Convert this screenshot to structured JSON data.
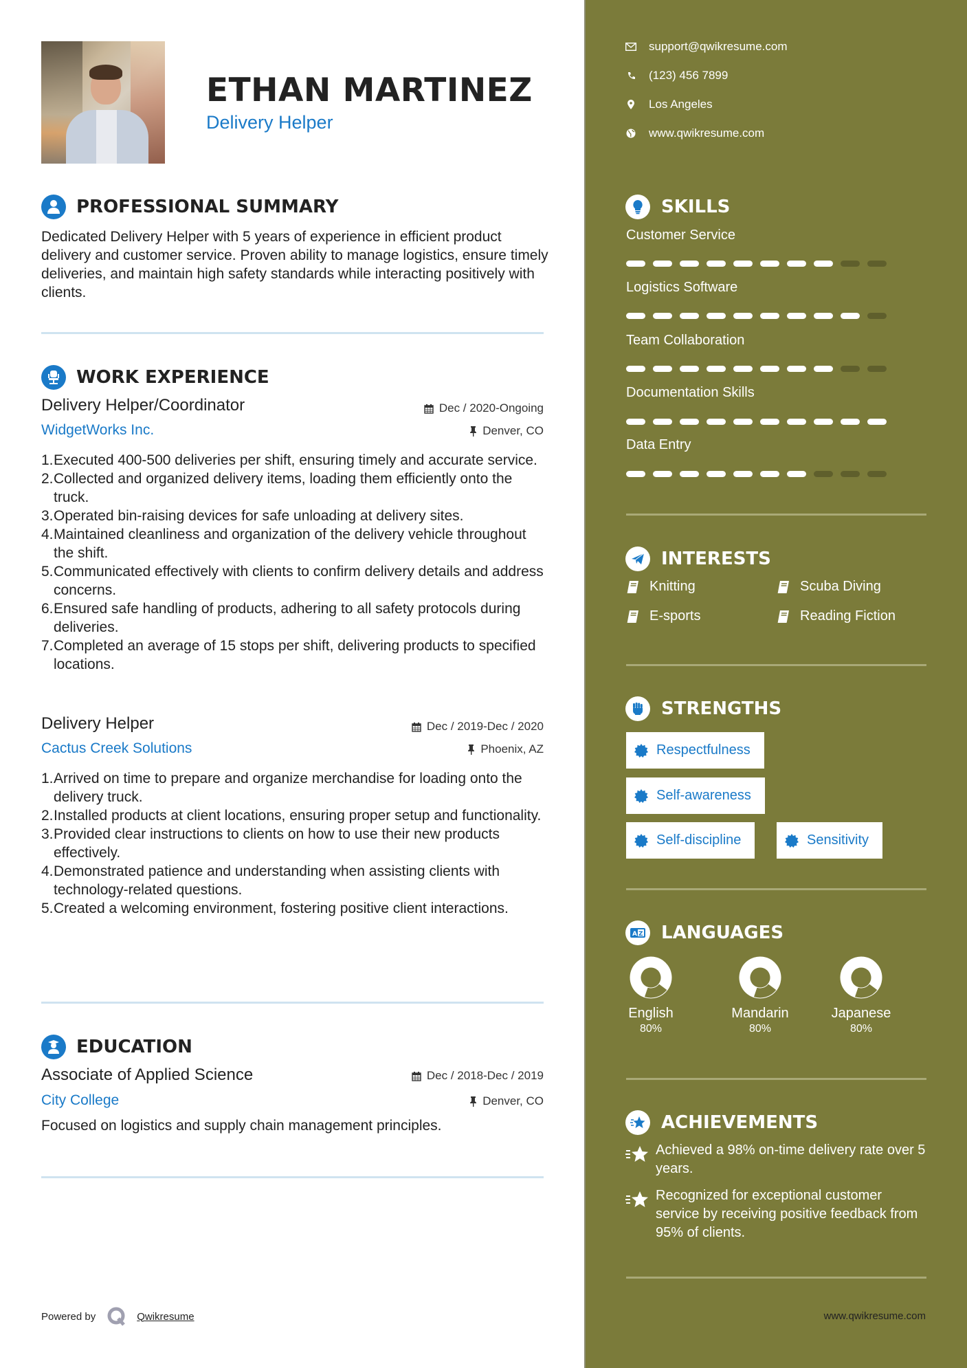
{
  "header": {
    "name": "ETHAN MARTINEZ",
    "title": "Delivery Helper",
    "photo_alt": "profile-photo"
  },
  "contact": [
    {
      "icon": "envelope-icon",
      "text": "support@qwikresume.com"
    },
    {
      "icon": "phone-icon",
      "text": "(123) 456 7899"
    },
    {
      "icon": "map-pin-icon",
      "text": "Los Angeles"
    },
    {
      "icon": "globe-icon",
      "text": "www.qwikresume.com"
    }
  ],
  "summary": {
    "heading": "PROFESSIONAL SUMMARY",
    "text": "Dedicated Delivery Helper with 5 years of experience in efficient product delivery and customer service. Proven ability to manage logistics, ensure timely deliveries, and maintain high safety standards while interacting positively with clients."
  },
  "experience": {
    "heading": "WORK EXPERIENCE",
    "jobs": [
      {
        "title": "Delivery Helper/Coordinator",
        "company": "WidgetWorks Inc.",
        "dates": "Dec / 2020-Ongoing",
        "location": "Denver, CO",
        "bullets": [
          "Executed 400-500 deliveries per shift, ensuring timely and accurate service.",
          "Collected and organized delivery items, loading them efficiently onto the truck.",
          "Operated bin-raising devices for safe unloading at delivery sites.",
          "Maintained cleanliness and organization of the delivery vehicle throughout the shift.",
          "Communicated effectively with clients to confirm delivery details and address concerns.",
          "Ensured safe handling of products, adhering to all safety protocols during deliveries.",
          "Completed an average of 15 stops per shift, delivering products to specified locations."
        ]
      },
      {
        "title": "Delivery Helper",
        "company": "Cactus Creek Solutions",
        "dates": "Dec / 2019-Dec / 2020",
        "location": "Phoenix, AZ",
        "bullets": [
          "Arrived on time to prepare and organize merchandise for loading onto the delivery truck.",
          "Installed products at client locations, ensuring proper setup and functionality.",
          "Provided clear instructions to clients on how to use their new products effectively.",
          "Demonstrated patience and understanding when assisting clients with technology-related questions.",
          "Created a welcoming environment, fostering positive client interactions."
        ]
      }
    ]
  },
  "education": {
    "heading": "EDUCATION",
    "degree": "Associate of Applied Science",
    "school": "City College",
    "dates": "Dec / 2018-Dec / 2019",
    "location": "Denver, CO",
    "description": "Focused on logistics and supply chain management principles."
  },
  "skills": {
    "heading": "SKILLS",
    "max": 10,
    "items": [
      {
        "name": "Customer Service",
        "level": 8
      },
      {
        "name": "Logistics Software",
        "level": 9
      },
      {
        "name": "Team Collaboration",
        "level": 8
      },
      {
        "name": "Documentation Skills",
        "level": 10
      },
      {
        "name": "Data Entry",
        "level": 7
      }
    ]
  },
  "interests": {
    "heading": "INTERESTS",
    "items": [
      "Knitting",
      "Scuba Diving",
      "E-sports",
      "Reading Fiction"
    ]
  },
  "strengths": {
    "heading": "STRENGTHS",
    "items": [
      "Respectfulness",
      "Self-awareness",
      "Self-discipline",
      "Sensitivity"
    ]
  },
  "languages": {
    "heading": "LANGUAGES",
    "items": [
      {
        "name": "English",
        "percent_label": "80%",
        "level": 0.8
      },
      {
        "name": "Mandarin",
        "percent_label": "80%",
        "level": 0.8
      },
      {
        "name": "Japanese",
        "percent_label": "80%",
        "level": 0.8
      }
    ]
  },
  "achievements": {
    "heading": "ACHIEVEMENTS",
    "items": [
      "Achieved a 98% on-time delivery rate over 5 years.",
      "Recognized for exceptional customer service by receiving positive feedback from 95% of clients."
    ]
  },
  "footer": {
    "powered_by": "Powered by",
    "brand": "Qwikresume",
    "url": "www.qwikresume.com"
  },
  "colors": {
    "sidebar": "#7b7b3a",
    "accent": "#1a7ac8",
    "skill_off": "#5f5f2c"
  }
}
